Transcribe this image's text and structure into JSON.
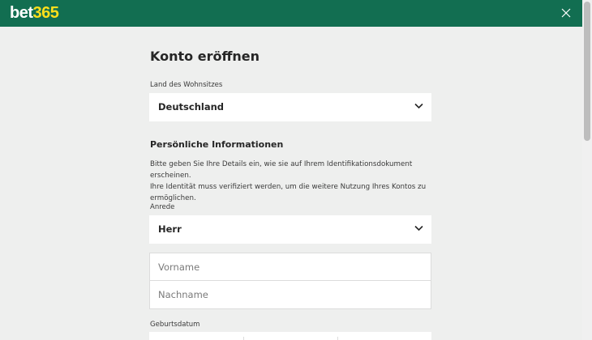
{
  "header": {
    "logo_part1": "bet",
    "logo_part2": "365"
  },
  "form": {
    "title": "Konto eröffnen",
    "country": {
      "label": "Land des Wohnsitzes",
      "value": "Deutschland"
    },
    "personal": {
      "title": "Persönliche Informationen",
      "info_line1": "Bitte geben Sie Ihre Details ein, wie sie auf Ihrem Identifikationsdokument erscheinen.",
      "info_line2": "Ihre Identität muss verifiziert werden, um die weitere Nutzung Ihres Kontos zu",
      "info_line3": "ermöglichen."
    },
    "salutation": {
      "label": "Anrede",
      "value": "Herr"
    },
    "first_name": {
      "placeholder": "Vorname"
    },
    "last_name": {
      "placeholder": "Nachname"
    },
    "birthdate": {
      "label": "Geburtsdatum"
    }
  },
  "colors": {
    "header_bg": "#126e51",
    "logo_accent": "#ffdf1b",
    "page_bg": "#eeefee"
  },
  "icons": {
    "close": "close-icon",
    "chevron": "chevron-down-icon"
  }
}
